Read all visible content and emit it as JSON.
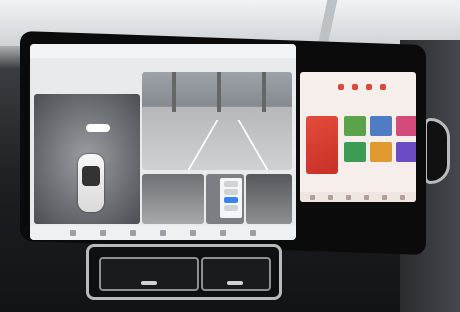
{
  "scene": "vehicle-dashboard-photo",
  "left_screen": {
    "status_left": "",
    "status_right": "",
    "topview_badge": "",
    "panel": {
      "buttons": 5,
      "active_index": 2
    },
    "dock_icons": [
      "home-icon",
      "apps-icon",
      "phone-icon",
      "music-icon",
      "nav-icon",
      "car-icon",
      "settings-icon"
    ]
  },
  "right_screen": {
    "header_icons": [
      "home-icon",
      "media-icon",
      "radio-icon",
      "bluetooth-icon"
    ],
    "big_card_text": "",
    "cards": [
      {
        "color": "#5aa34a"
      },
      {
        "color": "#4f7cc3"
      },
      {
        "color": "#d44a7a"
      },
      {
        "color": "#3e9b55"
      },
      {
        "color": "#e09a2f"
      },
      {
        "color": "#6c4cc4"
      }
    ],
    "dock_icons": [
      "home-icon",
      "grid-icon",
      "music-icon",
      "phone-icon",
      "settings-icon",
      "car-icon"
    ]
  },
  "colors": {
    "accent_blue": "#3b82f6",
    "accent_red": "#d94a3d"
  }
}
